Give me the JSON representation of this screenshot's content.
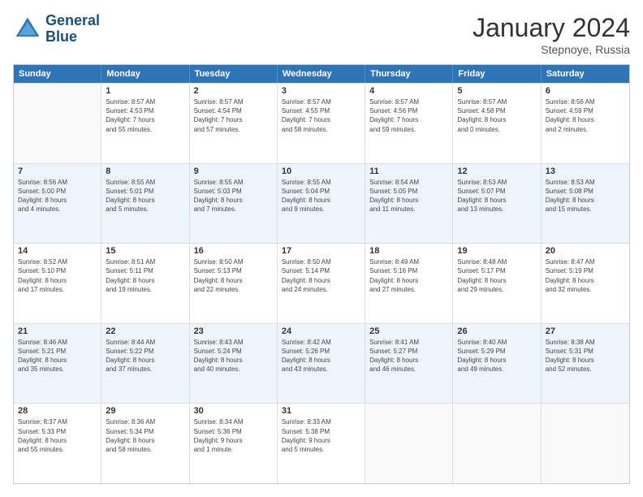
{
  "header": {
    "logo_line1": "General",
    "logo_line2": "Blue",
    "month": "January 2024",
    "location": "Stepnoye, Russia"
  },
  "weekdays": [
    "Sunday",
    "Monday",
    "Tuesday",
    "Wednesday",
    "Thursday",
    "Friday",
    "Saturday"
  ],
  "rows": [
    [
      {
        "day": "",
        "info": ""
      },
      {
        "day": "1",
        "info": "Sunrise: 8:57 AM\nSunset: 4:53 PM\nDaylight: 7 hours\nand 55 minutes."
      },
      {
        "day": "2",
        "info": "Sunrise: 8:57 AM\nSunset: 4:54 PM\nDaylight: 7 hours\nand 57 minutes."
      },
      {
        "day": "3",
        "info": "Sunrise: 8:57 AM\nSunset: 4:55 PM\nDaylight: 7 hours\nand 58 minutes."
      },
      {
        "day": "4",
        "info": "Sunrise: 8:57 AM\nSunset: 4:56 PM\nDaylight: 7 hours\nand 59 minutes."
      },
      {
        "day": "5",
        "info": "Sunrise: 8:57 AM\nSunset: 4:58 PM\nDaylight: 8 hours\nand 0 minutes."
      },
      {
        "day": "6",
        "info": "Sunrise: 8:56 AM\nSunset: 4:59 PM\nDaylight: 8 hours\nand 2 minutes."
      }
    ],
    [
      {
        "day": "7",
        "info": "Sunrise: 8:56 AM\nSunset: 5:00 PM\nDaylight: 8 hours\nand 4 minutes."
      },
      {
        "day": "8",
        "info": "Sunrise: 8:55 AM\nSunset: 5:01 PM\nDaylight: 8 hours\nand 5 minutes."
      },
      {
        "day": "9",
        "info": "Sunrise: 8:55 AM\nSunset: 5:03 PM\nDaylight: 8 hours\nand 7 minutes."
      },
      {
        "day": "10",
        "info": "Sunrise: 8:55 AM\nSunset: 5:04 PM\nDaylight: 8 hours\nand 9 minutes."
      },
      {
        "day": "11",
        "info": "Sunrise: 8:54 AM\nSunset: 5:05 PM\nDaylight: 8 hours\nand 11 minutes."
      },
      {
        "day": "12",
        "info": "Sunrise: 8:53 AM\nSunset: 5:07 PM\nDaylight: 8 hours\nand 13 minutes."
      },
      {
        "day": "13",
        "info": "Sunrise: 8:53 AM\nSunset: 5:08 PM\nDaylight: 8 hours\nand 15 minutes."
      }
    ],
    [
      {
        "day": "14",
        "info": "Sunrise: 8:52 AM\nSunset: 5:10 PM\nDaylight: 8 hours\nand 17 minutes."
      },
      {
        "day": "15",
        "info": "Sunrise: 8:51 AM\nSunset: 5:11 PM\nDaylight: 8 hours\nand 19 minutes."
      },
      {
        "day": "16",
        "info": "Sunrise: 8:50 AM\nSunset: 5:13 PM\nDaylight: 8 hours\nand 22 minutes."
      },
      {
        "day": "17",
        "info": "Sunrise: 8:50 AM\nSunset: 5:14 PM\nDaylight: 8 hours\nand 24 minutes."
      },
      {
        "day": "18",
        "info": "Sunrise: 8:49 AM\nSunset: 5:16 PM\nDaylight: 8 hours\nand 27 minutes."
      },
      {
        "day": "19",
        "info": "Sunrise: 8:48 AM\nSunset: 5:17 PM\nDaylight: 8 hours\nand 29 minutes."
      },
      {
        "day": "20",
        "info": "Sunrise: 8:47 AM\nSunset: 5:19 PM\nDaylight: 8 hours\nand 32 minutes."
      }
    ],
    [
      {
        "day": "21",
        "info": "Sunrise: 8:46 AM\nSunset: 5:21 PM\nDaylight: 8 hours\nand 35 minutes."
      },
      {
        "day": "22",
        "info": "Sunrise: 8:44 AM\nSunset: 5:22 PM\nDaylight: 8 hours\nand 37 minutes."
      },
      {
        "day": "23",
        "info": "Sunrise: 8:43 AM\nSunset: 5:24 PM\nDaylight: 8 hours\nand 40 minutes."
      },
      {
        "day": "24",
        "info": "Sunrise: 8:42 AM\nSunset: 5:26 PM\nDaylight: 8 hours\nand 43 minutes."
      },
      {
        "day": "25",
        "info": "Sunrise: 8:41 AM\nSunset: 5:27 PM\nDaylight: 8 hours\nand 46 minutes."
      },
      {
        "day": "26",
        "info": "Sunrise: 8:40 AM\nSunset: 5:29 PM\nDaylight: 8 hours\nand 49 minutes."
      },
      {
        "day": "27",
        "info": "Sunrise: 8:38 AM\nSunset: 5:31 PM\nDaylight: 8 hours\nand 52 minutes."
      }
    ],
    [
      {
        "day": "28",
        "info": "Sunrise: 8:37 AM\nSunset: 5:33 PM\nDaylight: 8 hours\nand 55 minutes."
      },
      {
        "day": "29",
        "info": "Sunrise: 8:36 AM\nSunset: 5:34 PM\nDaylight: 8 hours\nand 58 minutes."
      },
      {
        "day": "30",
        "info": "Sunrise: 8:34 AM\nSunset: 5:36 PM\nDaylight: 9 hours\nand 1 minute."
      },
      {
        "day": "31",
        "info": "Sunrise: 8:33 AM\nSunset: 5:38 PM\nDaylight: 9 hours\nand 5 minutes."
      },
      {
        "day": "",
        "info": ""
      },
      {
        "day": "",
        "info": ""
      },
      {
        "day": "",
        "info": ""
      }
    ]
  ]
}
